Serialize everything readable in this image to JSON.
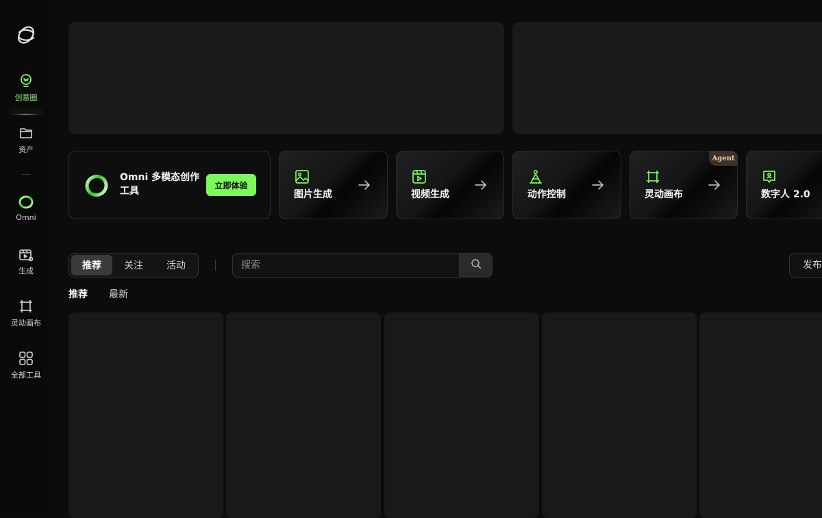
{
  "sidebar": {
    "items": [
      {
        "label": "创意圈",
        "icon": "bulb-icon"
      },
      {
        "label": "资产",
        "icon": "folder-icon"
      },
      {
        "label": "Omni",
        "icon": "omni-ring-icon"
      },
      {
        "label": "生成",
        "icon": "clapper-icon"
      },
      {
        "label": "灵动画布",
        "icon": "frame-icon"
      },
      {
        "label": "全部工具",
        "icon": "grid-icon"
      }
    ],
    "active_color": "#8cf36a"
  },
  "tools": {
    "omni": {
      "title": "Omni 多模态创作工具",
      "button": "立即体验"
    },
    "cards": [
      {
        "label": "图片生成",
        "icon": "image-icon"
      },
      {
        "label": "视频生成",
        "icon": "video-icon"
      },
      {
        "label": "动作控制",
        "icon": "figure-icon"
      },
      {
        "label": "灵动画布",
        "icon": "frame-icon",
        "badge": "Agent"
      },
      {
        "label": "数字人 2.0",
        "icon": "digital-human-icon"
      }
    ]
  },
  "feed": {
    "tabs": [
      "推荐",
      "关注",
      "活动"
    ],
    "active_tab": "推荐",
    "search": {
      "placeholder": "搜索"
    },
    "publish": "发布",
    "sort_tabs": [
      "推荐",
      "最新"
    ]
  },
  "colors": {
    "accent": "#7df85a",
    "background": "#0c0c0c",
    "card": "#1a1a1a"
  }
}
